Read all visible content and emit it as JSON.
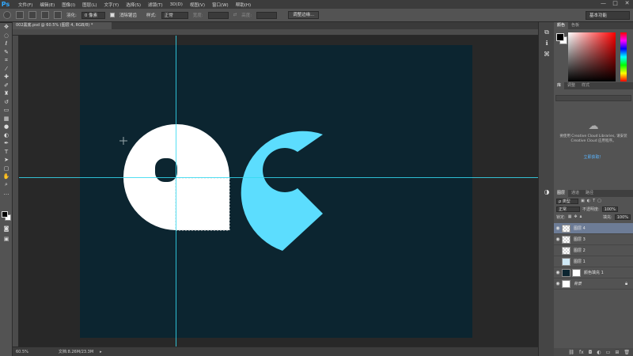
{
  "app": {
    "logo": "Ps"
  },
  "menu": [
    "文件(F)",
    "编辑(E)",
    "图像(I)",
    "图层(L)",
    "文字(Y)",
    "选择(S)",
    "滤镜(T)",
    "3D(D)",
    "视图(V)",
    "窗口(W)",
    "帮助(H)"
  ],
  "window_controls": [
    "—",
    "□",
    "✕"
  ],
  "options": {
    "feather_label": "羽化:",
    "feather_value": "0 像素",
    "antialias_label": "消除锯齿",
    "style_label": "样式:",
    "style_value": "正常",
    "width_label": "宽度:",
    "height_label": "高度:",
    "refine_button": "调整边缘..."
  },
  "workspace": "基本功能",
  "document": {
    "tab_title": "002黑底.psd @ 60.5% (图层 4, RGB/8) *",
    "zoom": "60.5%",
    "doc_info": "文档:8.26M/23.3M",
    "canvas_color": "#0c2530"
  },
  "panels": {
    "color_tabs": [
      "颜色",
      "色板"
    ],
    "library_tabs": [
      "库",
      "调整",
      "样式"
    ],
    "library_message": "要使用 Creative Cloud Libraries, 请安装 Creative Cloud 应用程序。",
    "library_link": "立即获取！",
    "layers_tabs": [
      "图层",
      "通道",
      "路径"
    ],
    "kind_filter": "ρ 类型",
    "blend_mode": "正常",
    "opacity_label": "不透明度:",
    "opacity_value": "100%",
    "lock_label": "锁定:",
    "fill_label": "填充:",
    "fill_value": "100%"
  },
  "layers": [
    {
      "name": "图层 4",
      "visible": true,
      "selected": true
    },
    {
      "name": "图层 3",
      "visible": true,
      "selected": false
    },
    {
      "name": "图层 2",
      "visible": false,
      "selected": false
    },
    {
      "name": "图层 1",
      "visible": false,
      "selected": false
    },
    {
      "name": "颜色填充 1",
      "visible": true,
      "selected": false
    },
    {
      "name": "背景",
      "visible": true,
      "selected": false
    }
  ],
  "colors": {
    "white_shape": "#ffffff",
    "cyan_shape": "#5cddfe",
    "guide": "#35d9f0",
    "selection_accent": "#6d7c96"
  }
}
